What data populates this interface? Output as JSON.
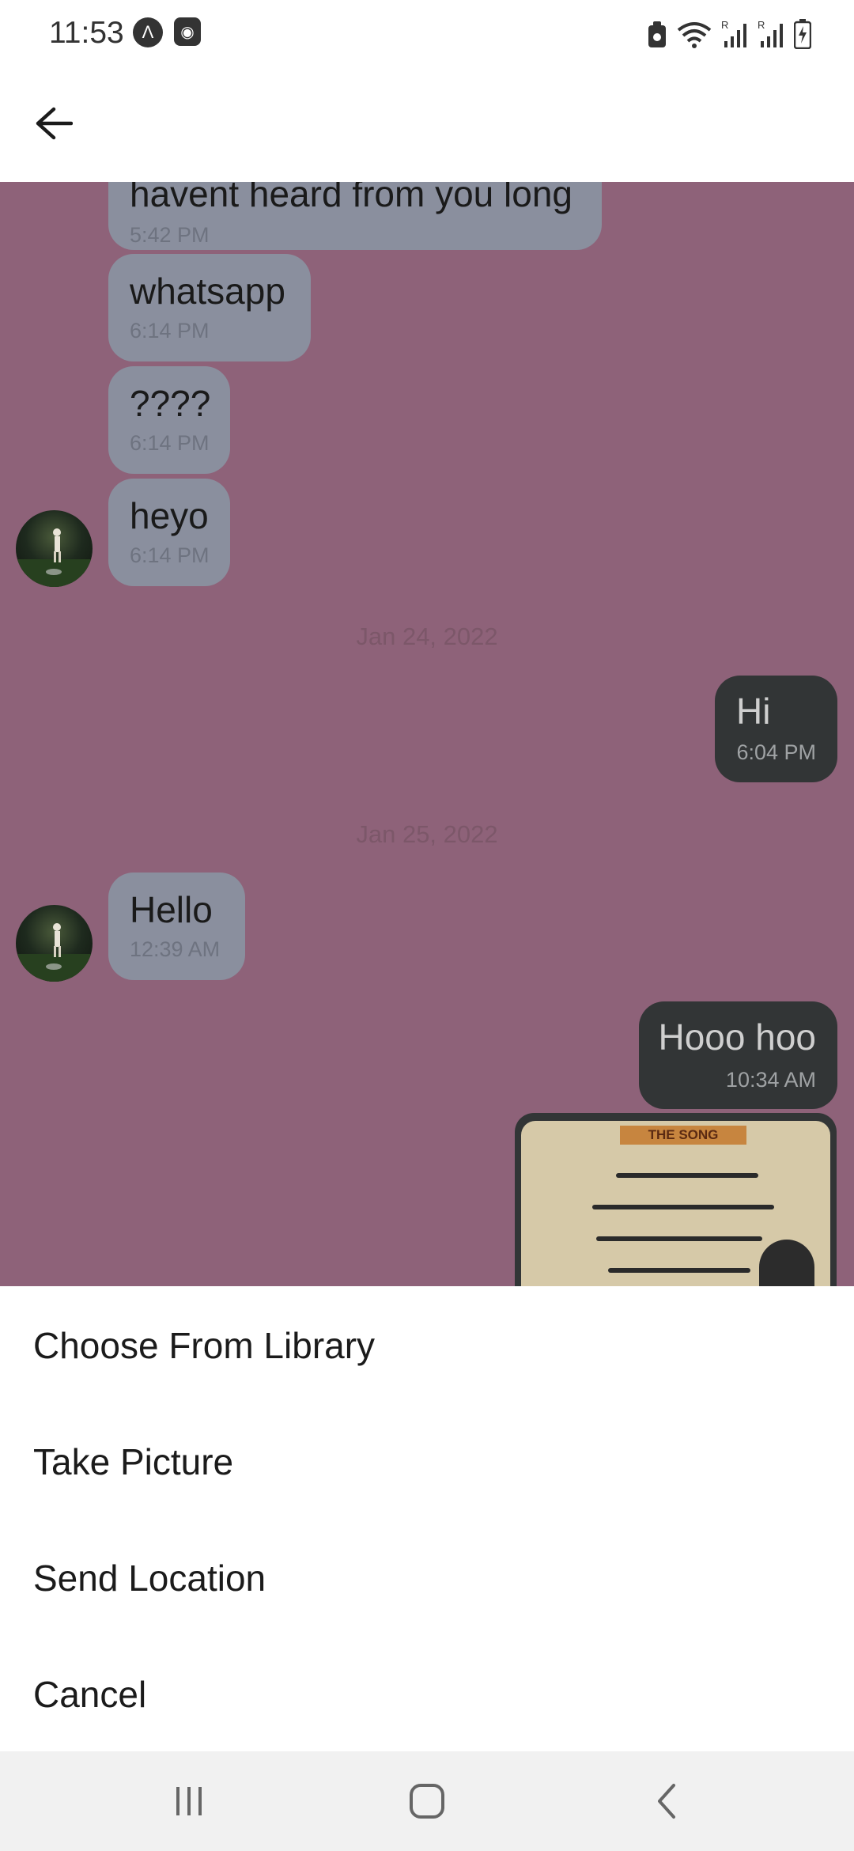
{
  "status_bar": {
    "time": "11:53",
    "left_icons": [
      "a-circle-icon",
      "camera-square-icon"
    ],
    "right_icons": [
      "lock-battery-icon",
      "wifi-icon",
      "signal-r-icon",
      "signal-r-icon",
      "battery-charging-icon"
    ]
  },
  "app_bar": {
    "back_icon": "arrow-left-icon"
  },
  "chat": {
    "background": "#8e6279",
    "messages": [
      {
        "direction": "in",
        "text": "havent heard from you long",
        "time": "5:42 PM"
      },
      {
        "direction": "in",
        "text": "whatsapp",
        "time": "6:14 PM"
      },
      {
        "direction": "in",
        "text": "????",
        "time": "6:14 PM"
      },
      {
        "direction": "in",
        "text": "heyo",
        "time": "6:14 PM"
      },
      {
        "direction": "out",
        "text": "Hi",
        "time": "6:04 PM"
      },
      {
        "direction": "in",
        "text": "Hello",
        "time": "12:39 AM"
      },
      {
        "direction": "out",
        "text": "Hooo hoo",
        "time": "10:34 AM"
      }
    ],
    "date_separators": [
      "Jan 24, 2022",
      "Jan 25, 2022"
    ],
    "image_message": {
      "tag": "THE SONG"
    }
  },
  "action_sheet": {
    "items": [
      "Choose From Library",
      "Take Picture",
      "Send Location",
      "Cancel"
    ]
  },
  "nav_bar": {
    "buttons": [
      "recent-apps-icon",
      "home-icon",
      "back-icon"
    ]
  },
  "colors": {
    "incoming_bubble": "#8a8f9e",
    "outgoing_bubble": "#323536",
    "sheet": "#ffffff",
    "nav_bar": "#f1f1f1"
  }
}
